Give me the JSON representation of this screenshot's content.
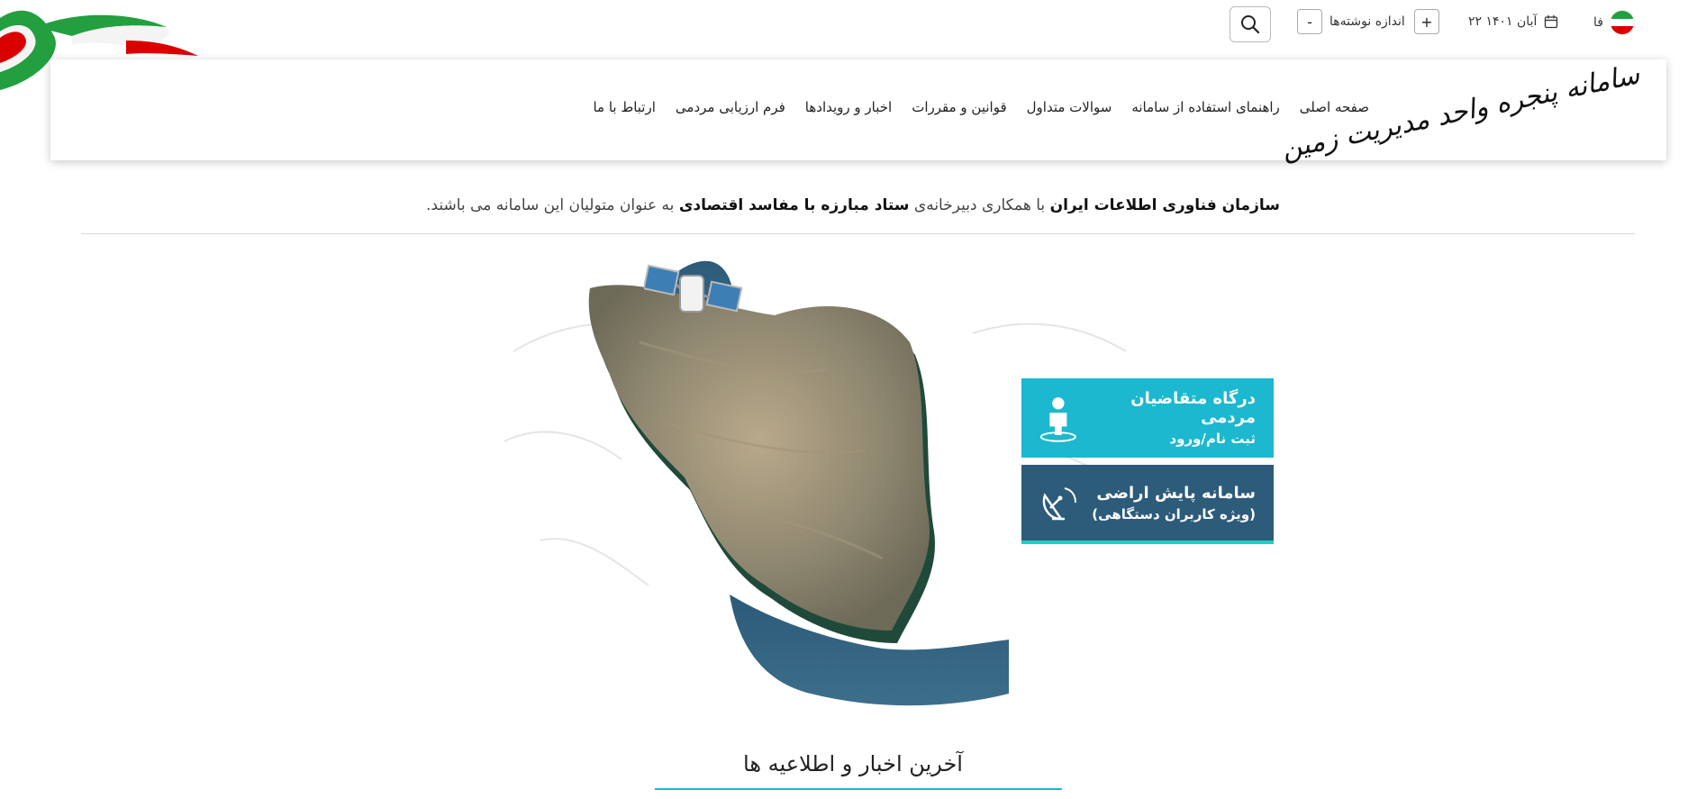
{
  "util": {
    "lang_label": "فا",
    "date": "۲۲ آبان ۱۴۰۱",
    "font_size_label": "اندازه نوشته‌ها",
    "font_decrease": "-",
    "font_increase": "+"
  },
  "header": {
    "logo_text": "سامانه پنجره واحد مدیریت زمین",
    "nav": [
      "صفحه اصلی",
      "راهنمای استفاده از سامانه",
      "سوالات متداول",
      "قوانین و مقررات",
      "اخبار و رویدادها",
      "فرم ارزیابی مردمی",
      "ارتباط با ما"
    ]
  },
  "intro": {
    "org1": "سازمان فناوری اطلاعات ایران",
    "text1": "با همکاری دبیرخانه‌ی",
    "org2": "ستاد مبارزه با مفاسد اقتصادی",
    "text2": "به عنوان متولیان این سامانه می باشند."
  },
  "portals": {
    "citizen_title": "درگاه متقاضیان مردمی",
    "citizen_sub": "ثبت نام/ورود",
    "monitor_title": "سامانه پایش اراضی",
    "monitor_sub": "(ویژه کاربران دستگاهی)"
  },
  "news": {
    "title": "آخرین اخبار و اطلاعیه ها"
  },
  "colors": {
    "portal_primary": "#1bb8cf",
    "portal_secondary": "#2d5b7a",
    "logo_green": "#2db34a",
    "logo_brown": "#8a4a22",
    "logo_blue": "#1c7bd0"
  },
  "icons": {
    "calendar": "calendar-icon",
    "search": "search-icon",
    "user_pin": "user-location-icon",
    "satellite_dish": "satellite-dish-icon"
  }
}
